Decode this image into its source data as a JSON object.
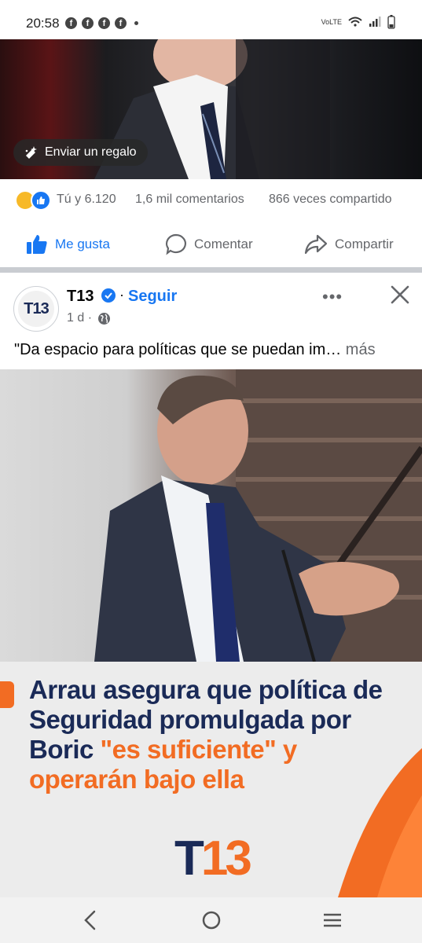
{
  "status_bar": {
    "time": "20:58",
    "network_label": "VoLTE",
    "notification_icons": [
      "facebook-icon",
      "facebook-icon",
      "facebook-icon",
      "facebook-icon"
    ]
  },
  "previous_post": {
    "gift_button_label": "Enviar un regalo",
    "reactions_label": "Tú y 6.120",
    "comments_label": "1,6 mil comentarios",
    "shares_label": "866 veces compartido",
    "actions": {
      "like": "Me gusta",
      "comment": "Comentar",
      "share": "Compartir"
    }
  },
  "post": {
    "author": "T13",
    "separator": "·",
    "follow_label": "Seguir",
    "timestamp": "1 d ·",
    "more_label": "•••",
    "text": "\"Da espacio para políticas que se puedan im…",
    "see_more": "más",
    "avatar_text": "T13",
    "card": {
      "headline_part1": "Arrau asegura que política de Seguridad promulgada por Boric ",
      "headline_part2": "\"es suficiente\" y operarán bajo ella",
      "logo_t": "T",
      "logo_n": "13"
    }
  },
  "colors": {
    "accent_blue": "#1877f2",
    "brand_navy": "#1a2a57",
    "brand_orange": "#f26c23",
    "secondary_text": "#65676b"
  }
}
